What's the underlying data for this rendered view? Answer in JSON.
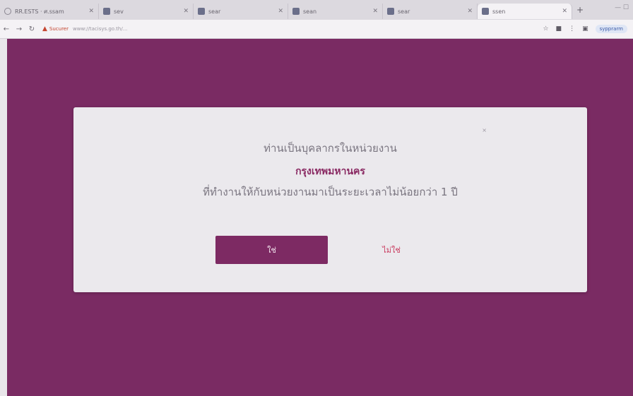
{
  "browser": {
    "tabs": [
      {
        "title": "RR.ESTS · ศ.ssam"
      },
      {
        "title": "sev"
      },
      {
        "title": "sear"
      },
      {
        "title": "sean"
      },
      {
        "title": "sear"
      },
      {
        "title": "ssen"
      }
    ],
    "new_tab": "+",
    "address": {
      "secure_label": "Sucurer",
      "url": "www://tacisys.go.th/...",
      "profile": "sypprarm"
    }
  },
  "modal": {
    "line1": "ท่านเป็นบุคลากรในหน่วยงาน",
    "org": "กรุงเทพมหานคร",
    "line3": "ที่ทำงานให้กับหน่วยงานมาเป็นระยะเวลาไม่น้อยกว่า 1 ปี",
    "yes_label": "ใช่",
    "no_label": "ไม่ใช่"
  },
  "colors": {
    "background": "#7a2b63",
    "primary_button": "#7d2a63",
    "org_text": "#8a2a63",
    "no_text": "#c93a5e"
  }
}
